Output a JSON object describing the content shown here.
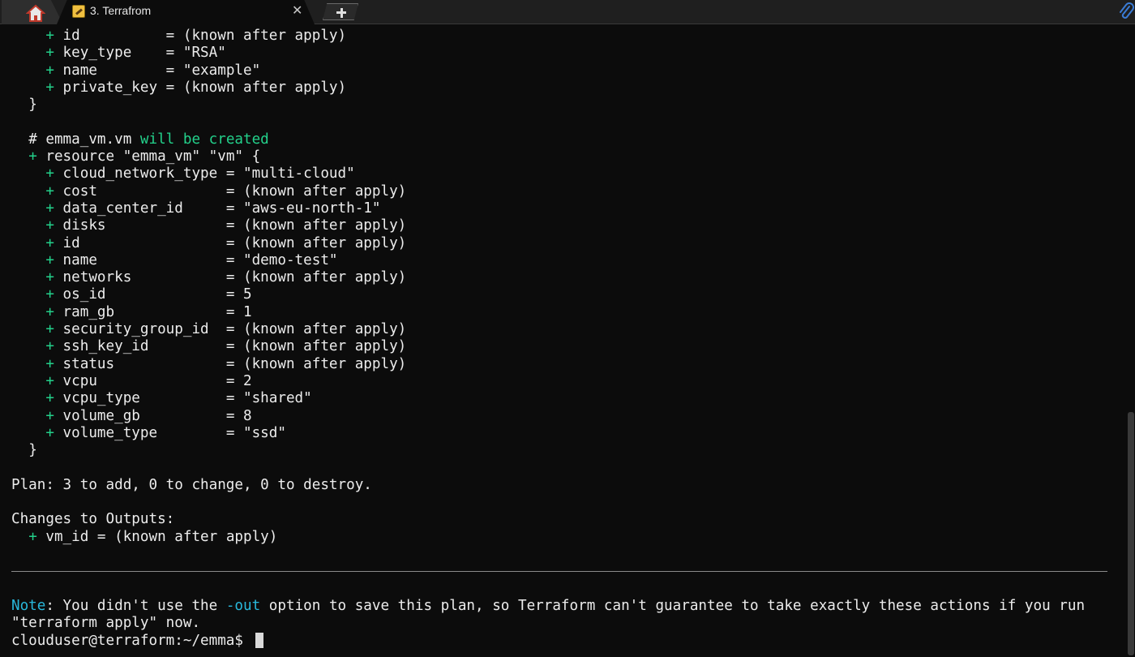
{
  "tabs": {
    "home_icon": "home-icon",
    "active_title": "3. Terrafrom",
    "active_icon": "terminal-session-icon",
    "close_glyph": "✕",
    "new_tab_icon": "plus-icon",
    "attach_icon": "paperclip-icon"
  },
  "colors": {
    "background": "#0c0c0c",
    "text": "#ececec",
    "green": "#23d18b",
    "cyan": "#29b8db"
  },
  "key_pair_tail": [
    {
      "plus": "+",
      "text": " id          = (known after apply)"
    },
    {
      "plus": "+",
      "text": " key_type    = \"RSA\""
    },
    {
      "plus": "+",
      "text": " name        = \"example\""
    },
    {
      "plus": "+",
      "text": " private_key = (known after apply)"
    }
  ],
  "close_brace": "}",
  "resource_header": {
    "prefix": "# emma_vm.vm",
    "status": " will be created",
    "plus": "+",
    "declaration": " resource \"emma_vm\" \"vm\" {"
  },
  "vm_attributes": [
    {
      "plus": "+",
      "text": " cloud_network_type = \"multi-cloud\""
    },
    {
      "plus": "+",
      "text": " cost               = (known after apply)"
    },
    {
      "plus": "+",
      "text": " data_center_id     = \"aws-eu-north-1\""
    },
    {
      "plus": "+",
      "text": " disks              = (known after apply)"
    },
    {
      "plus": "+",
      "text": " id                 = (known after apply)"
    },
    {
      "plus": "+",
      "text": " name               = \"demo-test\""
    },
    {
      "plus": "+",
      "text": " networks           = (known after apply)"
    },
    {
      "plus": "+",
      "text": " os_id              = 5"
    },
    {
      "plus": "+",
      "text": " ram_gb             = 1"
    },
    {
      "plus": "+",
      "text": " security_group_id  = (known after apply)"
    },
    {
      "plus": "+",
      "text": " ssh_key_id         = (known after apply)"
    },
    {
      "plus": "+",
      "text": " status             = (known after apply)"
    },
    {
      "plus": "+",
      "text": " vcpu               = 2"
    },
    {
      "plus": "+",
      "text": " vcpu_type          = \"shared\""
    },
    {
      "plus": "+",
      "text": " volume_gb          = 8"
    },
    {
      "plus": "+",
      "text": " volume_type        = \"ssd\""
    }
  ],
  "plan_summary": "Plan: 3 to add, 0 to change, 0 to destroy.",
  "outputs_heading": "Changes to Outputs:",
  "output_line": {
    "plus": "+",
    "text": " vm_id = (known after apply)"
  },
  "note": {
    "label": "Note",
    "part1": ": You didn't use the ",
    "flag": "-out",
    "part2": " option to save this plan, so Terraform can't guarantee to take exactly these actions if you run",
    "line2": "\"terraform apply\" now."
  },
  "prompt": "clouduser@terraform:~/emma$ "
}
